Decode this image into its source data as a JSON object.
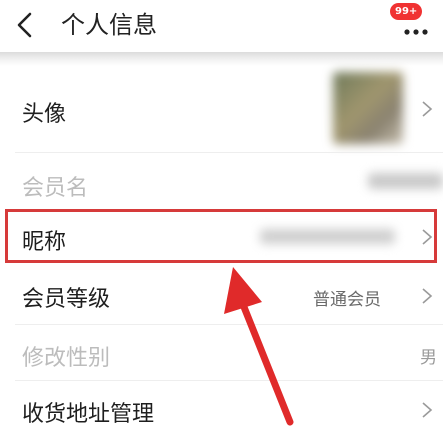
{
  "header": {
    "title": "个人信息",
    "badge": "99+"
  },
  "rows": [
    {
      "label": "头像",
      "value": "",
      "disabled": false,
      "chevron": true
    },
    {
      "label": "会员名",
      "value": "",
      "disabled": true,
      "chevron": false
    },
    {
      "label": "昵称",
      "value": "",
      "disabled": false,
      "chevron": true
    },
    {
      "label": "会员等级",
      "value": "普通会员",
      "disabled": false,
      "chevron": true
    },
    {
      "label": "修改性别",
      "value": "男",
      "disabled": true,
      "chevron": false
    },
    {
      "label": "收货地址管理",
      "value": "",
      "disabled": false,
      "chevron": true
    }
  ],
  "colors": {
    "highlight": "#d63a3a",
    "badge": "#f03232"
  },
  "icons": [
    "back-icon",
    "more-icon",
    "chevron-right-icon",
    "arrow-annotation"
  ]
}
